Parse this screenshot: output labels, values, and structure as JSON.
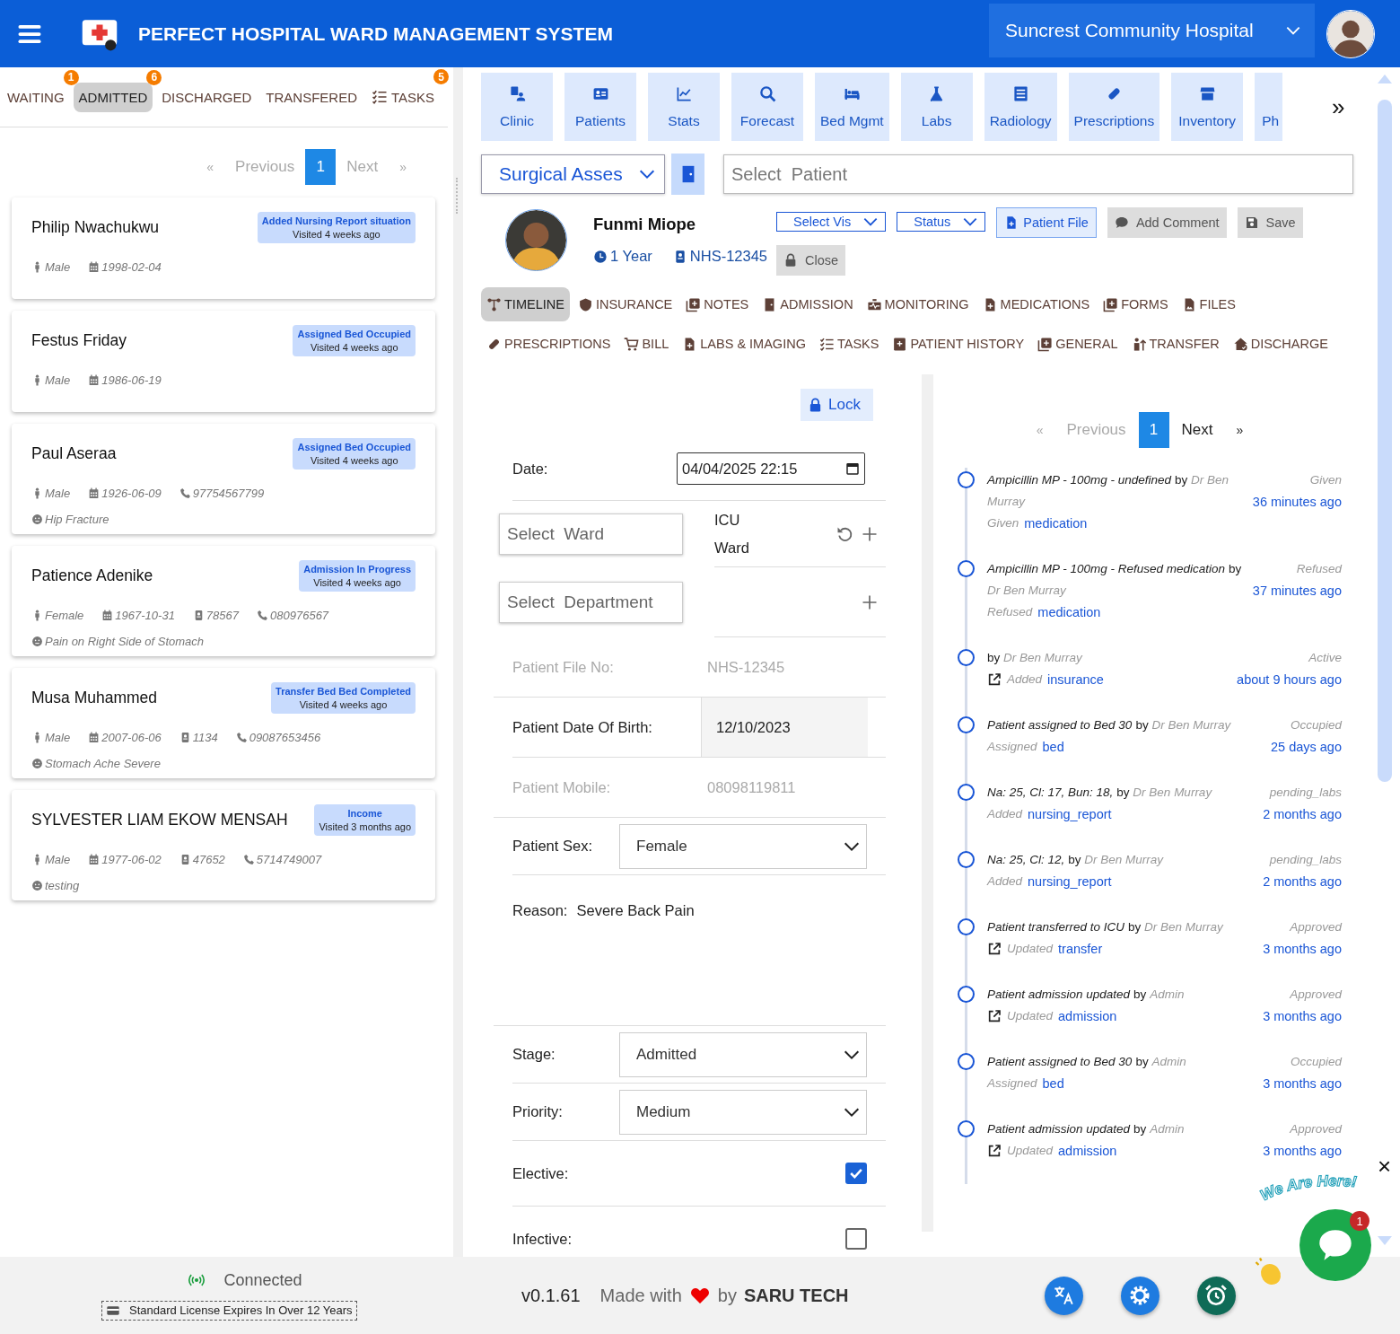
{
  "header": {
    "title": "PERFECT HOSPITAL WARD MANAGEMENT SYSTEM",
    "hospital": "Suncrest Community Hospital"
  },
  "list_tabs": [
    {
      "label": "WAITING",
      "badge": "1",
      "selected": false
    },
    {
      "label": "ADMITTED",
      "badge": "6",
      "selected": true
    },
    {
      "label": "DISCHARGED",
      "selected": false
    },
    {
      "label": "TRANSFERED",
      "selected": false
    },
    {
      "label": "TASKS",
      "badge": "5",
      "selected": false
    }
  ],
  "list_pagination": {
    "first": "«",
    "previous": "Previous",
    "pages": [
      {
        "label": "1",
        "selected": true
      }
    ],
    "next": "Next",
    "last": "»"
  },
  "patients": [
    {
      "name": "Philip Nwachukwu",
      "status": "Added Nursing Report situation",
      "visited": "Visited 4 weeks ago",
      "gender": "Male",
      "dob": "1998-02-04"
    },
    {
      "name": "Festus Friday",
      "status": "Assigned Bed Occupied",
      "visited": "Visited 4 weeks ago",
      "gender": "Male",
      "dob": "1986-06-19"
    },
    {
      "name": "Paul Aseraa",
      "status": "Assigned Bed Occupied",
      "visited": "Visited 4 weeks ago",
      "gender": "Male",
      "dob": "1926-06-09",
      "phone": "97754567799",
      "reason": "Hip Fracture"
    },
    {
      "name": "Patience Adenike",
      "status": "Admission In Progress",
      "visited": "Visited 4 weeks ago",
      "gender": "Female",
      "dob": "1967-10-31",
      "file_no": "78567",
      "phone": "080976567",
      "reason": "Pain on Right Side of Stomach"
    },
    {
      "name": "Musa Muhammed",
      "status": "Transfer Bed Bed Completed",
      "visited": "Visited 4 weeks ago",
      "gender": "Male",
      "dob": "2007-06-06",
      "file_no": "1134",
      "phone": "09087653456",
      "reason": "Stomach Ache Severe"
    },
    {
      "name": "SYLVESTER LIAM EKOW MENSAH",
      "status": "Income",
      "visited": "Visited 3 months ago",
      "gender": "Male",
      "dob": "1977-06-02",
      "file_no": "47652",
      "phone": "5714749007",
      "reason": "testing"
    }
  ],
  "modules": [
    {
      "label": "Clinic"
    },
    {
      "label": "Patients"
    },
    {
      "label": "Stats"
    },
    {
      "label": "Forecast"
    },
    {
      "label": "Bed Mgmt"
    },
    {
      "label": "Labs"
    },
    {
      "label": "Radiology"
    },
    {
      "label": "Prescriptions"
    },
    {
      "label": "Inventory"
    },
    {
      "label": "Ph"
    }
  ],
  "modules_more": "»",
  "department": "Surgical Asses",
  "patient_search": {
    "placeholder": "Select  Patient"
  },
  "patient": {
    "name": "Funmi Miope",
    "age": "1 Year",
    "file_no": "NHS-12345"
  },
  "actions": [
    {
      "label": "Select Vis",
      "kind": "select"
    },
    {
      "label": "Status",
      "kind": "select"
    },
    {
      "label": "Patient File",
      "kind": "primary"
    },
    {
      "label": "Add Comment",
      "kind": "secondary"
    },
    {
      "label": "Save",
      "kind": "secondary"
    },
    {
      "label": "Close",
      "kind": "secondary"
    }
  ],
  "record_tabs": [
    [
      {
        "label": "TIMELINE",
        "selected": true
      },
      {
        "label": "INSURANCE",
        "selected": false
      },
      {
        "label": "NOTES",
        "selected": false
      },
      {
        "label": "ADMISSION",
        "selected": false
      },
      {
        "label": "MONITORING",
        "selected": false
      },
      {
        "label": "MEDICATIONS",
        "selected": false
      },
      {
        "label": "FORMS",
        "selected": false
      },
      {
        "label": "FILES",
        "selected": false
      }
    ],
    [
      {
        "label": "PRESCRIPTIONS",
        "selected": false
      },
      {
        "label": "BILL",
        "selected": false
      },
      {
        "label": "LABS & IMAGING",
        "selected": false
      },
      {
        "label": "TASKS",
        "selected": false
      },
      {
        "label": "PATIENT HISTORY",
        "selected": false
      },
      {
        "label": "GENERAL",
        "selected": false
      },
      {
        "label": "TRANSFER",
        "selected": false
      },
      {
        "label": "DISCHARGE",
        "selected": false
      }
    ]
  ],
  "form": {
    "lock": "Lock",
    "fields": [
      {
        "kind": "datetime",
        "label": "Date:",
        "value": "04/04/2025 22:15"
      },
      {
        "kind": "ward",
        "placeholder": "Select  Ward",
        "lines": [
          "ICU",
          "Ward"
        ]
      },
      {
        "kind": "department",
        "placeholder": "Select  Department"
      },
      {
        "kind": "readonly",
        "label": "Patient File No:",
        "value": "NHS-12345",
        "disabled": true
      },
      {
        "kind": "boxed",
        "label": "Patient Date Of Birth:",
        "value": "12/10/2023"
      },
      {
        "kind": "readonly",
        "label": "Patient Mobile:",
        "value": "08098119811",
        "disabled": true
      },
      {
        "kind": "select",
        "label": "Patient Sex:",
        "value": "Female"
      },
      {
        "kind": "text",
        "label": "Reason:",
        "value": "Severe Back Pain"
      },
      {
        "kind": "select",
        "label": "Stage:",
        "value": "Admitted"
      },
      {
        "kind": "select",
        "label": "Priority:",
        "value": "Medium"
      },
      {
        "kind": "checkbox",
        "label": "Elective:",
        "checked": true
      },
      {
        "kind": "checkbox",
        "label": "Infective:",
        "checked": false
      }
    ]
  },
  "timeline": {
    "pagination": {
      "first": "«",
      "previous": "Previous",
      "pages": [
        {
          "label": "1",
          "selected": true
        }
      ],
      "next": "Next",
      "last": "»"
    },
    "entries": [
      {
        "title": "Ampicillin MP - 100mg - undefined",
        "by": "by",
        "author": "Dr Ben Murray",
        "status": "Given",
        "action": "Given",
        "target": "medication",
        "time": "36 minutes ago",
        "link_icon": false
      },
      {
        "title": "Ampicillin MP - 100mg - Refused medication",
        "by": "by",
        "author": "Dr Ben Murray",
        "status": "Refused",
        "action": "Refused",
        "target": "medication",
        "time": "37 minutes ago",
        "link_icon": false
      },
      {
        "by": "by",
        "author": "Dr Ben Murray",
        "status": "Active",
        "action": "Added",
        "target": "insurance",
        "time": "about 9 hours ago",
        "link_icon": true
      },
      {
        "title": "Patient assigned to Bed 30",
        "by": "by",
        "author": "Dr Ben Murray",
        "status": "Occupied",
        "action": "Assigned",
        "target": "bed",
        "time": "25 days ago",
        "link_icon": false
      },
      {
        "title": "Na: 25, Cl: 17, Bun: 18,",
        "by": "by",
        "author": "Dr Ben Murray",
        "status": "pending_labs",
        "action": "Added",
        "target": "nursing_report",
        "time": "2 months ago",
        "link_icon": false
      },
      {
        "title": "Na: 25, Cl: 12,",
        "by": "by",
        "author": "Dr Ben Murray",
        "status": "pending_labs",
        "action": "Added",
        "target": "nursing_report",
        "time": "2 months ago",
        "link_icon": false
      },
      {
        "title": "Patient transferred to ICU",
        "by": "by",
        "author": "Dr Ben Murray",
        "status": "Approved",
        "action": "Updated",
        "target": "transfer",
        "time": "3 months ago",
        "link_icon": true
      },
      {
        "title": "Patient admission updated",
        "by": "by",
        "author": "Admin",
        "status": "Approved",
        "action": "Updated",
        "target": "admission",
        "time": "3 months ago",
        "link_icon": true
      },
      {
        "title": "Patient assigned to Bed 30",
        "by": "by",
        "author": "Admin",
        "status": "Occupied",
        "action": "Assigned",
        "target": "bed",
        "time": "3 months ago",
        "link_icon": false
      },
      {
        "title": "Patient admission updated",
        "by": "by",
        "author": "Admin",
        "status": "Approved",
        "action": "Updated",
        "target": "admission",
        "time": "3 months ago",
        "link_icon": true
      }
    ]
  },
  "footer": {
    "connection": "Connected",
    "license": "Standard License Expires In Over 12 Years",
    "version": "v0.1.61",
    "made_with": "Made with",
    "by": "by",
    "company": "SARU TECH"
  },
  "chat": {
    "caption": "We Are Here!",
    "badge": "1",
    "close": "×"
  }
}
